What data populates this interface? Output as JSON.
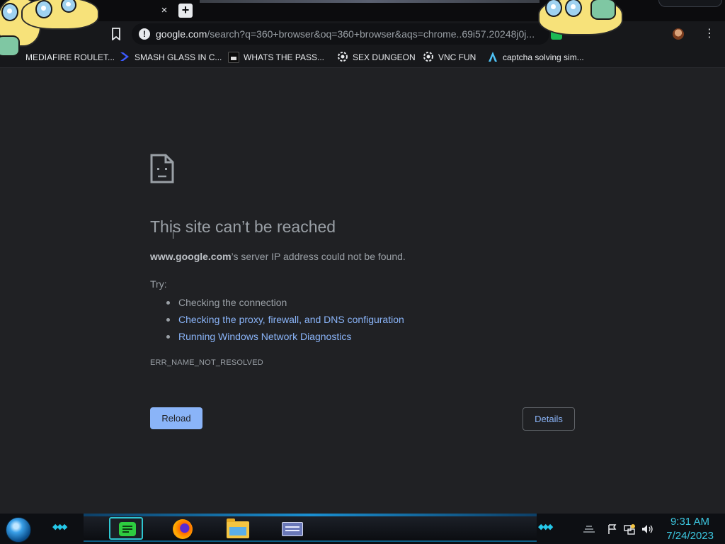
{
  "browser": {
    "tab_close_glyph": "×",
    "new_tab_glyph": "+",
    "url_host": "google.com",
    "url_path": "/search?q=360+browser&oq=360+browser&aqs=chrome..69i57.20248j0j...",
    "menu_glyph": "⋮"
  },
  "bookmarks": [
    {
      "label": "MEDIAFIRE ROULET...",
      "icon": "mediafire-icon"
    },
    {
      "label": "SMASH GLASS IN C...",
      "icon": "chevron-icon"
    },
    {
      "label": "WHATS THE PASS...",
      "icon": "terminal-icon"
    },
    {
      "label": "SEX DUNGEON",
      "icon": "gear-icon"
    },
    {
      "label": "VNC FUN",
      "icon": "gear-icon"
    },
    {
      "label": "captcha solving sim...",
      "icon": "caret-up-icon"
    }
  ],
  "error_page": {
    "title": "This site can’t be reached",
    "host": "www.google.com",
    "desc_suffix": "’s server IP address could not be found.",
    "try_label": "Try:",
    "suggestions": [
      "Checking the connection",
      "Checking the proxy, firewall, and DNS configuration",
      "Running Windows Network Diagnostics"
    ],
    "error_code": "ERR_NAME_NOT_RESOLVED",
    "reload_label": "Reload",
    "details_label": "Details"
  },
  "taskbar": {
    "apps": [
      "notes-app",
      "firefox",
      "file-explorer",
      "remote-desktop"
    ],
    "time": "9:31 AM",
    "date": "7/24/2023"
  },
  "colors": {
    "page_bg": "#202124",
    "link": "#8ab4f8",
    "text_muted": "#9aa0a6",
    "clock": "#3cc7e0"
  }
}
